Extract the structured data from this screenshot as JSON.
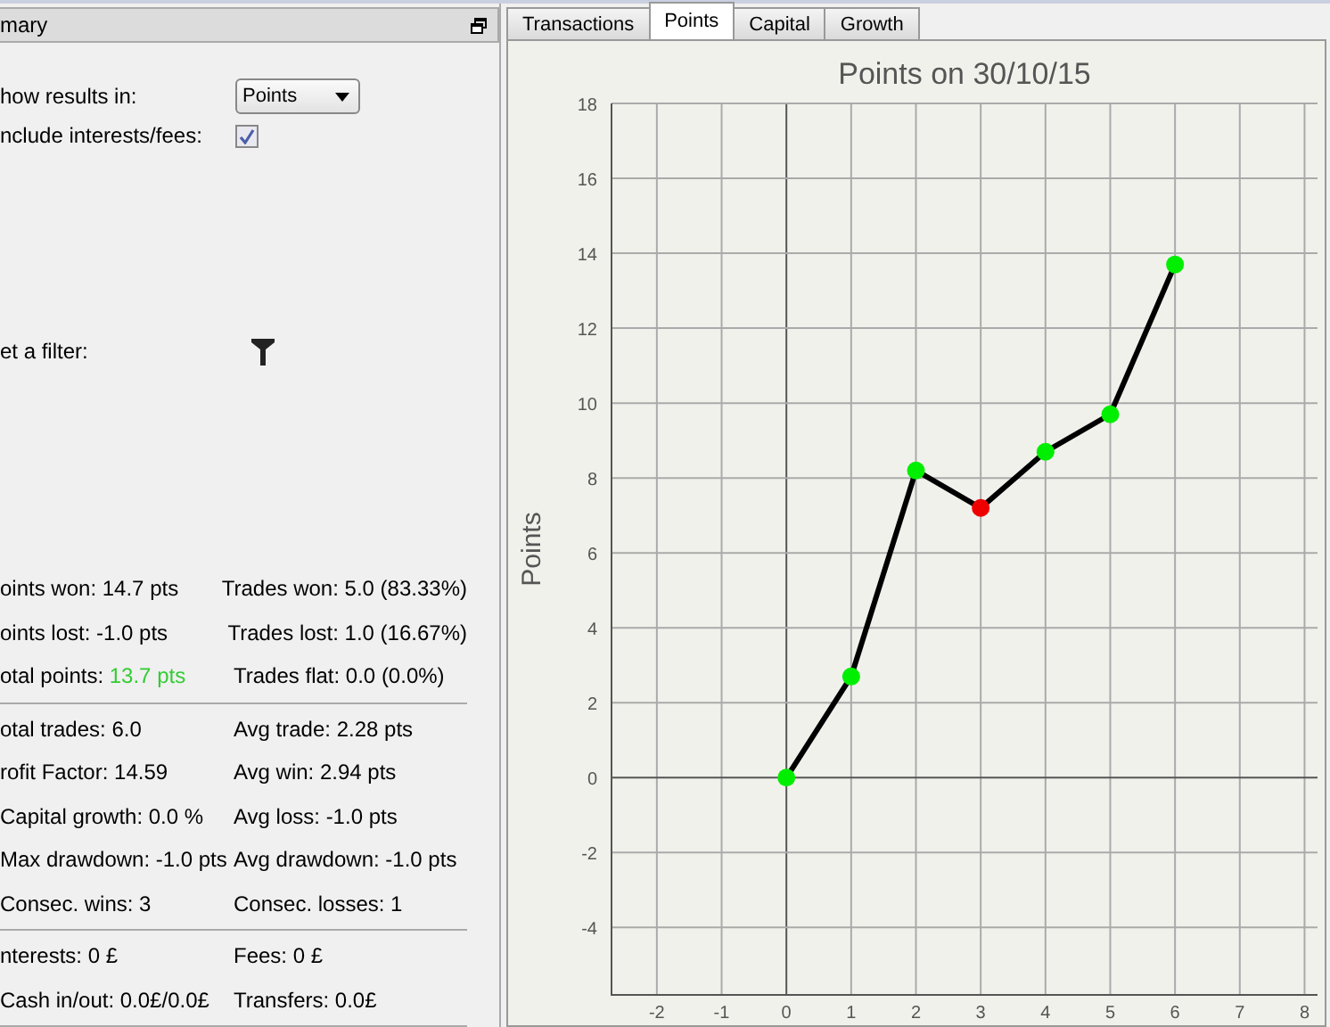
{
  "panel": {
    "title": "mary",
    "fields": [
      {
        "kind": "select",
        "label": "how results in:",
        "value": "Points"
      },
      {
        "kind": "checkbox",
        "label": "nclude interests/fees:",
        "checked": true
      },
      {
        "kind": "filter",
        "label": "et a filter:"
      }
    ],
    "stat_groups": [
      [
        [
          {
            "label": "oints won:",
            "value": "14.7 pts"
          },
          {
            "label": "Trades won:",
            "value": "5.0 (83.33%)"
          }
        ],
        [
          {
            "label": "oints lost:",
            "value": "-1.0 pts"
          },
          {
            "label": "Trades lost:",
            "value": "1.0 (16.67%)"
          }
        ],
        [
          {
            "label": "otal points:",
            "value": "13.7 pts",
            "color": "#33cc33"
          },
          {
            "label": "Trades flat:",
            "value": "0.0 (0.0%)"
          }
        ]
      ],
      [
        [
          {
            "label": "otal trades:",
            "value": "6.0"
          },
          {
            "label": "Avg trade:",
            "value": "2.28 pts"
          }
        ],
        [
          {
            "label": "rofit Factor:",
            "value": "14.59"
          },
          {
            "label": "Avg win:",
            "value": "2.94 pts"
          }
        ],
        [
          {
            "label": "Capital growth:",
            "value": "0.0 %"
          },
          {
            "label": "Avg loss:",
            "value": "-1.0 pts"
          }
        ],
        [
          {
            "label": "Max drawdown:",
            "value": "-1.0 pts"
          },
          {
            "label": "Avg drawdown:",
            "value": "-1.0 pts"
          }
        ],
        [
          {
            "label": "Consec. wins:",
            "value": "3"
          },
          {
            "label": "Consec. losses:",
            "value": "1"
          }
        ]
      ],
      [
        [
          {
            "label": "nterests:",
            "value": "0 £"
          },
          {
            "label": "Fees:",
            "value": "0 £"
          }
        ],
        [
          {
            "label": "Cash in/out:",
            "value": "0.0£/0.0£"
          },
          {
            "label": "Transfers:",
            "value": "0.0£"
          }
        ]
      ]
    ]
  },
  "tabs": [
    {
      "label": "Transactions",
      "selected": false
    },
    {
      "label": "Points",
      "selected": true
    },
    {
      "label": "Capital",
      "selected": false
    },
    {
      "label": "Growth",
      "selected": false
    }
  ],
  "chart": {
    "chart_data": {
      "type": "line",
      "title": "Points on 30/10/15",
      "ylabel": "Points",
      "x": [
        0,
        1,
        2,
        3,
        4,
        5,
        6
      ],
      "series": [
        {
          "color": "#000000",
          "marker": true,
          "values": [
            0,
            2.7,
            8.2,
            7.2,
            8.7,
            9.7,
            13.7
          ]
        }
      ],
      "grid": true,
      "xlim": [
        -2.7,
        8.2
      ],
      "ylim": [
        -5.8,
        18
      ],
      "xticks": [
        -2,
        -1,
        0,
        1,
        2,
        3,
        4,
        5,
        6,
        7,
        8
      ],
      "yticks": [
        -4,
        -2,
        0,
        2,
        4,
        6,
        8,
        10,
        12,
        14,
        16,
        18
      ]
    }
  }
}
